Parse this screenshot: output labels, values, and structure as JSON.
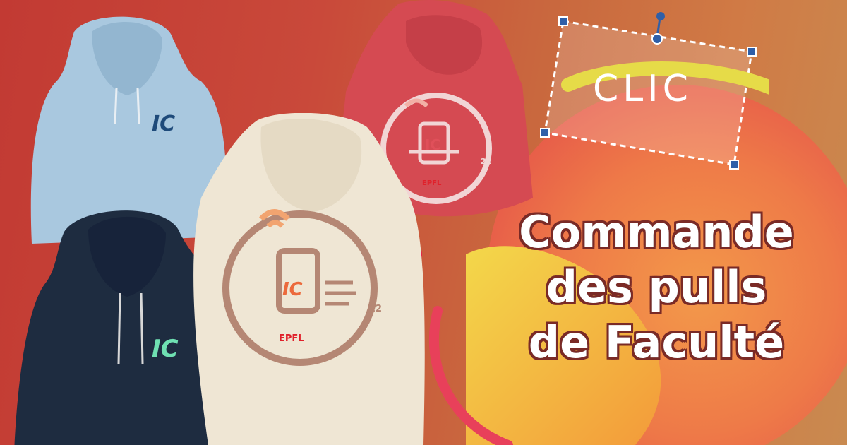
{
  "logo": {
    "text": "CLIC"
  },
  "headline": {
    "line1": "Commande",
    "line2": "des pulls",
    "line3": "de Faculté"
  },
  "hoodies": [
    {
      "color_name": "sky-blue",
      "color": "#a9c8df",
      "print": "IC"
    },
    {
      "color_name": "navy",
      "color": "#1e2c40",
      "print": "IC"
    },
    {
      "color_name": "cream",
      "color": "#efe6d4",
      "print": "IC",
      "number": "22",
      "brand": "EPFL"
    },
    {
      "color_name": "red",
      "color": "#d54a52",
      "print": "IC",
      "number": "22",
      "brand": "EPFL"
    }
  ],
  "colors": {
    "accent_yellow": "#e8d84a",
    "accent_orange": "#f08a45",
    "accent_pink": "#e8405a",
    "handle_blue": "#2f5fa8"
  }
}
